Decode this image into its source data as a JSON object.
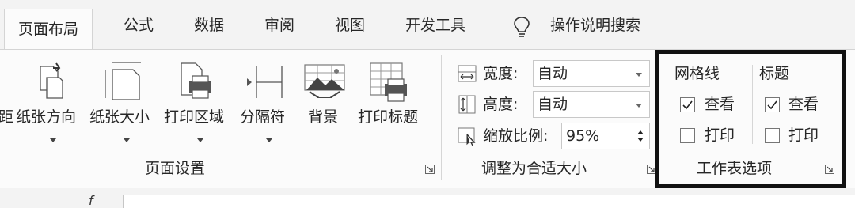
{
  "tabs": [
    "页面布局",
    "公式",
    "数据",
    "审阅",
    "视图",
    "开发工具"
  ],
  "search": {
    "icon": "lightbulb-icon",
    "label": "操作说明搜索"
  },
  "page_setup": {
    "partial_button": "距",
    "buttons": [
      {
        "icon": "orientation-icon",
        "label": "纸张方向"
      },
      {
        "icon": "paper-size-icon",
        "label": "纸张大小"
      },
      {
        "icon": "print-area-icon",
        "label": "打印区域"
      },
      {
        "icon": "page-break-icon",
        "label": "分隔符"
      },
      {
        "icon": "background-icon",
        "label": "背景"
      },
      {
        "icon": "print-titles-icon",
        "label": "打印标题"
      }
    ],
    "group_label": "页面设置"
  },
  "scale_to_fit": {
    "width": {
      "label": "宽度:",
      "value": "自动"
    },
    "height": {
      "label": "高度:",
      "value": "自动"
    },
    "scale": {
      "label": "缩放比例:",
      "value": "95%"
    },
    "group_label": "调整为合适大小"
  },
  "sheet_options": {
    "gridlines": {
      "header": "网格线",
      "view_label": "查看",
      "view_checked": true,
      "print_label": "打印",
      "print_checked": false
    },
    "headings": {
      "header": "标题",
      "view_label": "查看",
      "view_checked": true,
      "print_label": "打印",
      "print_checked": false
    },
    "group_label": "工作表选项"
  },
  "formula_bar": {
    "fx_partial": "f"
  }
}
